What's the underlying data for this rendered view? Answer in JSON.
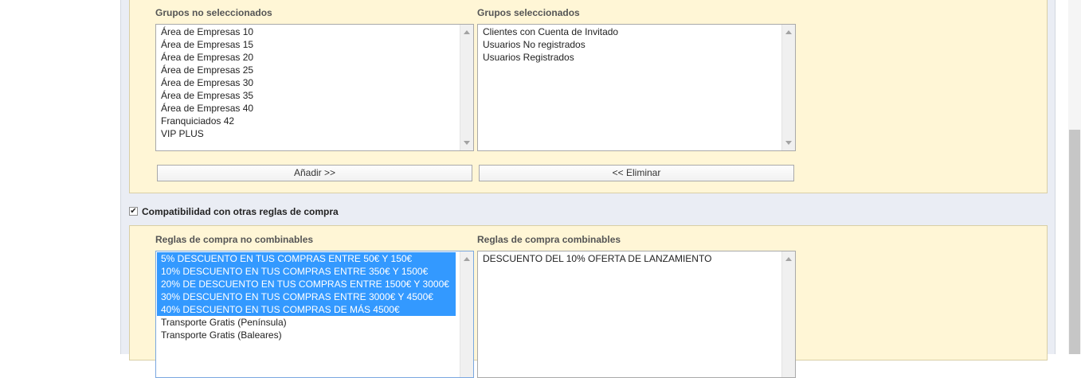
{
  "groups": {
    "unselected_label": "Grupos no seleccionados",
    "selected_label": "Grupos seleccionados",
    "unselected_items": [
      "Área de Empresas 10",
      "Área de Empresas 15",
      "Área de Empresas 20",
      "Área de Empresas 25",
      "Área de Empresas 30",
      "Área de Empresas 35",
      "Área de Empresas 40",
      "Franquiciados 42",
      "VIP PLUS"
    ],
    "selected_items": [
      "Clientes con Cuenta de Invitado",
      "Usuarios No registrados",
      "Usuarios Registrados"
    ],
    "add_button": "Añadir >>",
    "remove_button": "<< Eliminar"
  },
  "compatibility": {
    "label": "Compatibilidad con otras reglas de compra",
    "checked": true
  },
  "rules": {
    "non_combinable_label": "Reglas de compra no combinables",
    "combinable_label": "Reglas de compra combinables",
    "non_combinable_items": [
      "5% DESCUENTO EN TUS COMPRAS ENTRE 50€ Y 150€",
      "10% DESCUENTO EN TUS COMPRAS ENTRE 350€ Y 1500€",
      "20% DE DESCUENTO EN TUS COMPRAS ENTRE 1500€ Y 3000€",
      "30% DESCUENTO EN TUS COMPRAS ENTRE 3000€ Y 4500€",
      "40% DESCUENTO EN TUS COMPRAS DE MÁS 4500€",
      "Transporte Gratis (Península)",
      "Transporte Gratis (Baleares)"
    ],
    "non_combinable_selected_count": 5,
    "combinable_items": [
      "DESCUENTO DEL 10% OFERTA DE LANZAMIENTO"
    ]
  },
  "colors": {
    "panel_background": "#fff6d6",
    "selection": "#3399ff",
    "content_background": "#eaedf4"
  }
}
